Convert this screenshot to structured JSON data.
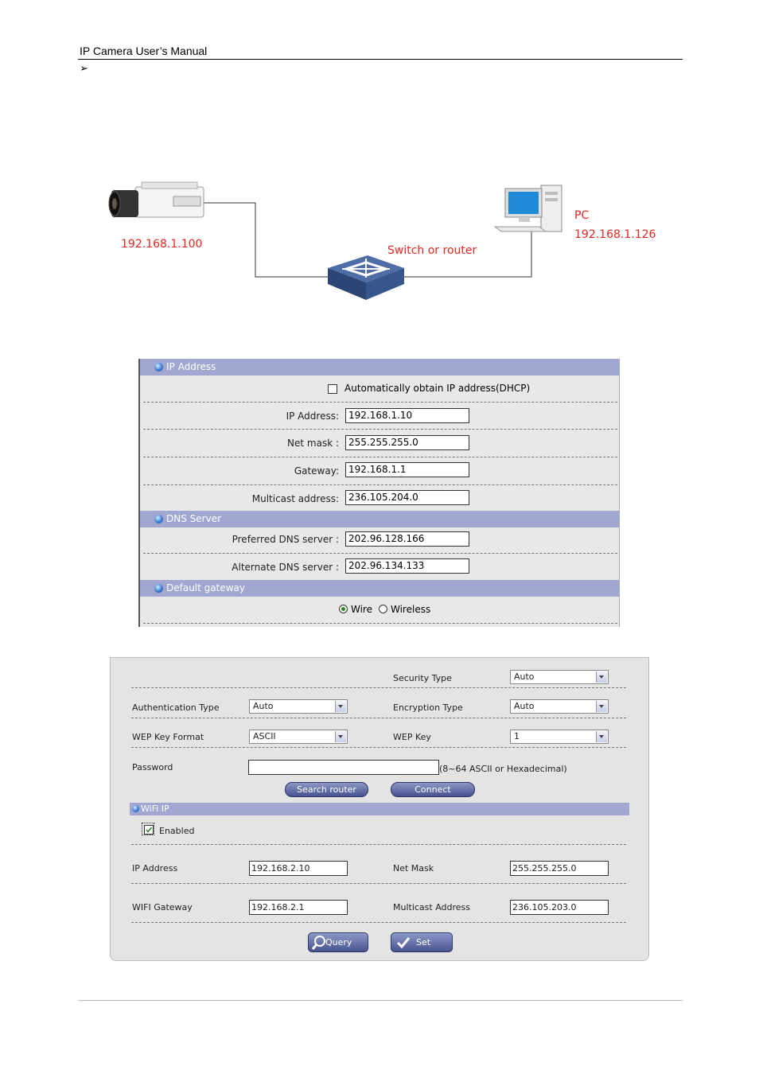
{
  "header": {
    "title": "IP Camera User’s Manual",
    "bullet": "➢"
  },
  "diagram": {
    "camera_ip": "192.168.1.100",
    "switch_label": "Switch or router",
    "pc_label": "PC",
    "pc_ip": "192.168.1.126"
  },
  "ip_panel": {
    "section_ip": "IP Address",
    "dhcp_label": "Automatically obtain IP address(DHCP)",
    "ip_label": "IP Address:",
    "ip_value": "192.168.1.10",
    "mask_label": "Net mask :",
    "mask_value": "255.255.255.0",
    "gateway_label": "Gateway:",
    "gateway_value": "192.168.1.1",
    "multicast_label": "Multicast address:",
    "multicast_value": "236.105.204.0",
    "section_dns": "DNS Server",
    "dns1_label": "Preferred DNS server :",
    "dns1_value": "202.96.128.166",
    "dns2_label": "Alternate DNS server :",
    "dns2_value": "202.96.134.133",
    "section_gateway": "Default gateway",
    "wire_label": "Wire",
    "wireless_label": "Wireless"
  },
  "wifi_panel": {
    "security_type_label": "Security Type",
    "security_type_value": "Auto",
    "auth_type_label": "Authentication Type",
    "auth_type_value": "Auto",
    "encryption_type_label": "Encryption Type",
    "encryption_type_value": "Auto",
    "wep_format_label": "WEP Key Format",
    "wep_format_value": "ASCII",
    "wep_key_label": "WEP Key",
    "wep_key_value": "1",
    "password_label": "Password",
    "password_value": "",
    "password_hint": "(8~64 ASCII or Hexadecimal)",
    "search_router_label": "Search router",
    "connect_label": "Connect",
    "section_wifi_ip": "WiFi IP",
    "enabled_label": "Enabled",
    "ip_label": "IP Address",
    "ip_value": "192.168.2.10",
    "netmask_label": "Net Mask",
    "netmask_value": "255.255.255.0",
    "gateway_label": "WIFI Gateway",
    "gateway_value": "192.168.2.1",
    "multicast_label": "Multicast Address",
    "multicast_value": "236.105.203.0",
    "query_label": "Query",
    "set_label": "Set"
  }
}
